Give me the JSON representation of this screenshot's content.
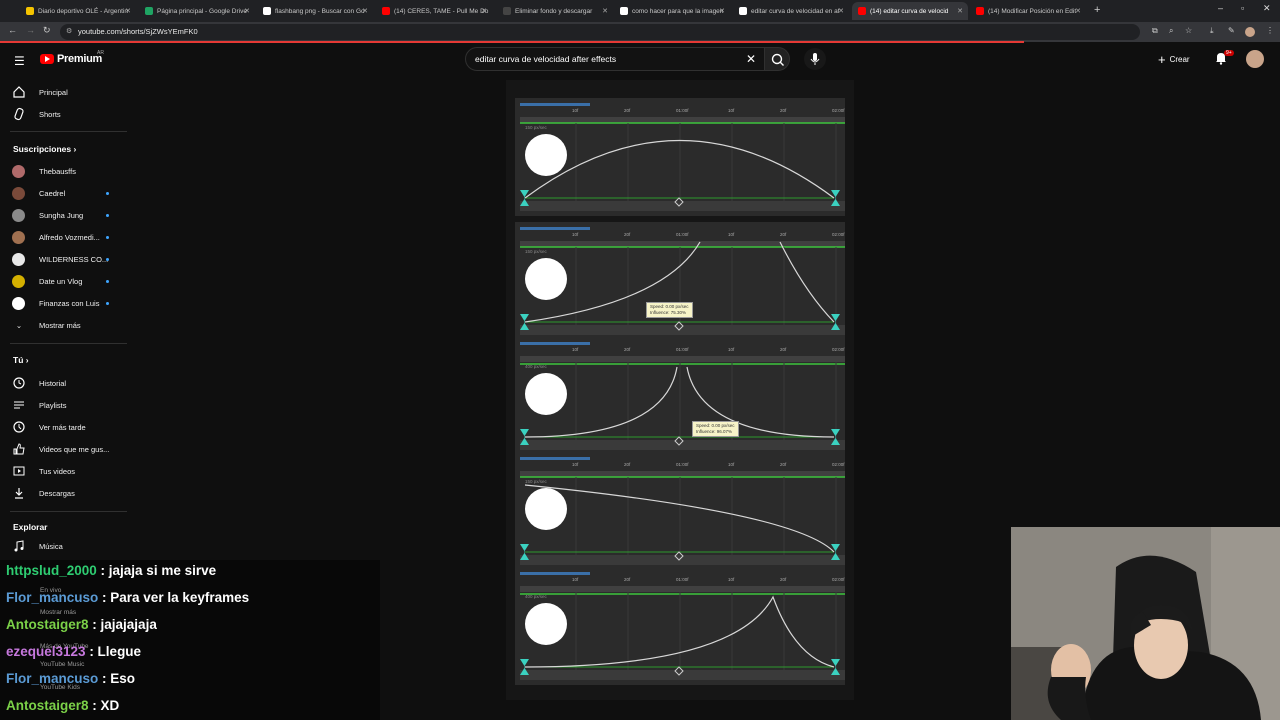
{
  "browser": {
    "tabs": [
      {
        "title": "Diario deportivo OLÉ - Argentin",
        "color": "#f5c400",
        "active": false
      },
      {
        "title": "Página principal - Google Drive",
        "color": "#1fa463",
        "active": false
      },
      {
        "title": "flashbang png - Buscar con Go",
        "color": "#ffffff",
        "active": false
      },
      {
        "title": "(14) CERES, TAME - Pull Me Do",
        "color": "#ff0000",
        "active": false
      },
      {
        "title": "Eliminar fondo y descargar",
        "color": "#444444",
        "active": false
      },
      {
        "title": "como hacer para que la imagen",
        "color": "#ffffff",
        "active": false
      },
      {
        "title": "editar curva de velocidad en af",
        "color": "#ffffff",
        "active": false
      },
      {
        "title": "(14) editar curva de velocid",
        "color": "#ff0000",
        "active": true
      },
      {
        "title": "(14) Modificar Posición en Edit",
        "color": "#ff0000",
        "active": false
      }
    ],
    "url": "youtube.com/shorts/SjZWsYEmFK0"
  },
  "header": {
    "logo_text": "Premium",
    "region": "AR",
    "search_query": "editar curva de velocidad after effects",
    "create_label": "Crear",
    "notifications": "9+"
  },
  "sidebar": {
    "main": [
      {
        "label": "Principal",
        "icon": "home-icon"
      },
      {
        "label": "Shorts",
        "icon": "shorts-icon"
      }
    ],
    "subscriptions_title": "Suscripciones",
    "subscriptions": [
      {
        "label": "Thebausffs",
        "color": "#b06a6a",
        "live": false
      },
      {
        "label": "Caedrel",
        "color": "#7a4a3a",
        "live": true
      },
      {
        "label": "Sungha Jung",
        "color": "#8a8a8a",
        "live": true
      },
      {
        "label": "Alfredo Vozmedi...",
        "color": "#a07050",
        "live": true
      },
      {
        "label": "WILDERNESS CO...",
        "color": "#e8e8e8",
        "live": true
      },
      {
        "label": "Date un Vlog",
        "color": "#d4b000",
        "live": true
      },
      {
        "label": "Finanzas con Luis",
        "color": "#ffffff",
        "live": true
      }
    ],
    "show_more": "Mostrar más",
    "you_title": "Tú",
    "you": [
      {
        "label": "Historial",
        "icon": "history-icon"
      },
      {
        "label": "Playlists",
        "icon": "playlists-icon"
      },
      {
        "label": "Ver más tarde",
        "icon": "watch-later-icon"
      },
      {
        "label": "Videos que me gus...",
        "icon": "like-icon"
      },
      {
        "label": "Tus videos",
        "icon": "your-videos-icon"
      },
      {
        "label": "Descargas",
        "icon": "download-icon"
      }
    ],
    "explore_title": "Explorar",
    "explore": [
      {
        "label": "Música",
        "icon": "music-icon"
      }
    ],
    "ghost": [
      "En vivo",
      "Mostrar más",
      "Más de YouTube",
      "YouTube Music",
      "YouTube Kids"
    ]
  },
  "video": {
    "graphs": [
      {
        "label": "150 px/sec",
        "ticks": [
          "10f",
          "20f",
          "01:00f",
          "10f",
          "20f",
          "02:00f"
        ]
      },
      {
        "label": "150 px/sec",
        "ticks": [
          "10f",
          "20f",
          "01:00f",
          "10f",
          "20f",
          "02:00f"
        ],
        "tooltip": [
          "Speed: 0.00 px/sec",
          "Influence: 75.30%"
        ]
      },
      {
        "label": "400 px/sec",
        "ticks": [
          "10f",
          "20f",
          "01:00f",
          "10f",
          "20f",
          "02:00f"
        ],
        "tooltip": [
          "Speed: 0.00 px/sec",
          "Influence: 96.07%"
        ]
      },
      {
        "label": "150 px/sec",
        "ticks": [
          "10f",
          "20f",
          "01:00f",
          "10f",
          "20f",
          "02:00f"
        ]
      },
      {
        "label": "400 px/sec",
        "ticks": [
          "10f",
          "20f",
          "01:00f",
          "10f",
          "20f",
          "02:00f"
        ]
      }
    ]
  },
  "chat": [
    {
      "user": "httpslud_2000",
      "msg": " : jajaja si me sirve",
      "color": "#2ecc71"
    },
    {
      "user": "Flor_mancuso",
      "msg": " : Para ver la keyframes",
      "color": "#5b9bd5"
    },
    {
      "user": "Antostaiger8",
      "msg": " : jajajajaja",
      "color": "#7bd148"
    },
    {
      "user": "ezequel3123",
      "msg": " : Llegue",
      "color": "#c678dd"
    },
    {
      "user": "Flor_mancuso",
      "msg": " : Eso",
      "color": "#5b9bd5"
    },
    {
      "user": "Antostaiger8",
      "msg": " : XD",
      "color": "#7bd148"
    }
  ]
}
